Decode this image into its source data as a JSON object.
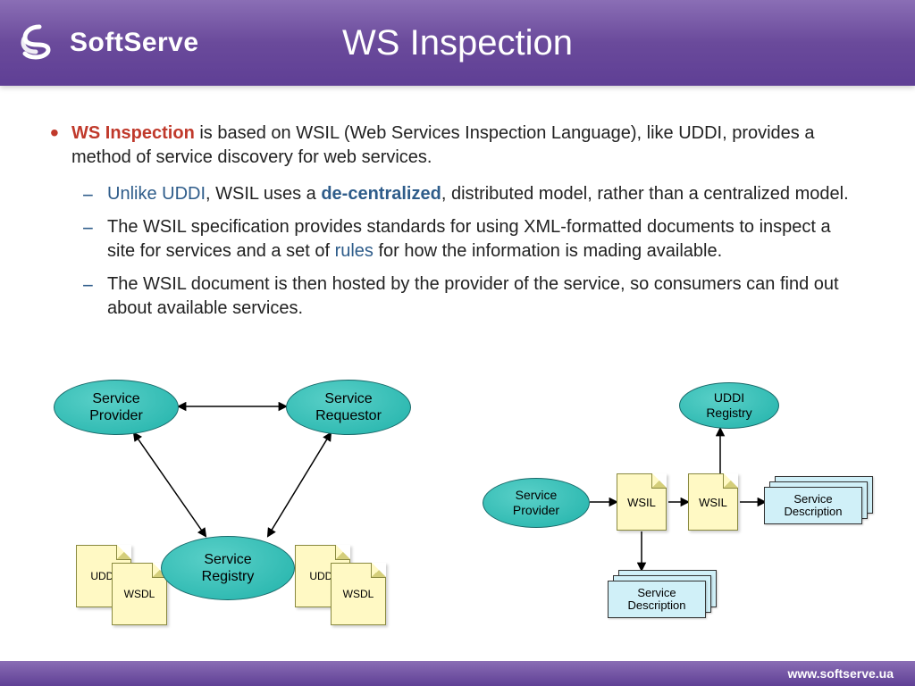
{
  "header": {
    "brand": "SoftServe",
    "title": "WS Inspection"
  },
  "content": {
    "main_strong": "WS Inspection",
    "main_rest": " is based on WSIL (Web Services Inspection Language), like UDDI, provides a method of service discovery for web services.",
    "sub": [
      {
        "pre_blue": "Unlike UDDI",
        "mid": ", WSIL uses a ",
        "bold_blue": "de-centralized",
        "post": ", distributed model, rather than a centralized model."
      },
      {
        "pre": "The WSIL specification provides standards for using XML-formatted documents to inspect a site for services and a set of ",
        "blue": "rules",
        "post": " for how the information is mading available."
      },
      {
        "text": " The WSIL document is then hosted by the provider of the service, so consumers can find out about available services."
      }
    ]
  },
  "diagram_left": {
    "provider": "Service\nProvider",
    "requestor": "Service\nRequestor",
    "registry": "Service\nRegistry",
    "doc_uddi": "UDDI",
    "doc_wsdl": "WSDL"
  },
  "diagram_right": {
    "provider": "Service\nProvider",
    "uddi": "UDDI\nRegistry",
    "wsil": "WSIL",
    "svc_desc": "Service\nDescription"
  },
  "footer": {
    "url": "www.softserve.ua"
  }
}
